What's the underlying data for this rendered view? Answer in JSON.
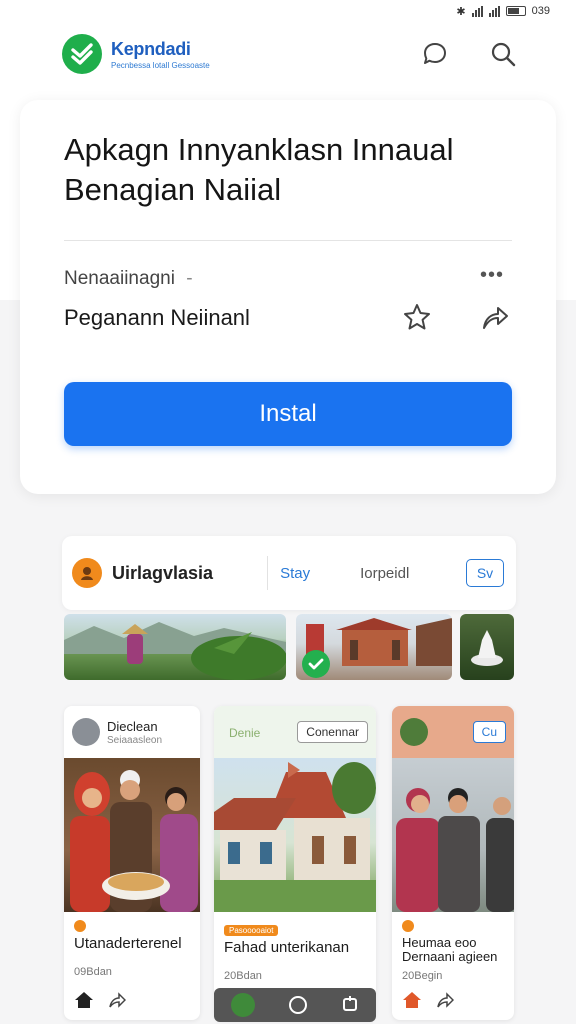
{
  "status_bar": {
    "time": "039"
  },
  "header": {
    "brand_name": "Kepndadi",
    "brand_tagline": "Pecnbessa lotall Gessoaste"
  },
  "app": {
    "title_line1": "Apkagn Innyanklasn Innaual",
    "title_line2": "Benagian Naiial",
    "developer": "Nenaaiinagni",
    "developer_suffix": "-",
    "more_label": "•••",
    "category": "Peganann Neiinanl",
    "install_label": "Instal"
  },
  "publisher_bar": {
    "name": "Uirlagvlasia",
    "tab_a": "Stay",
    "tab_b": "Iorpeidl",
    "button": "Sv"
  },
  "colors": {
    "accent": "#1a73f0",
    "brand_green": "#1fae4b",
    "orange": "#f08a1c"
  },
  "feed": [
    {
      "header_title": "Dieclean",
      "header_sub": "Seiaaasleon",
      "title": "Utanaderterenel",
      "meta": "09Bdan"
    },
    {
      "header_title": "",
      "header_sub": "Denie",
      "button": "Conennar",
      "badge": "Pasooooaiot",
      "title": "Fahad unterikanan",
      "meta": "20Bdan"
    },
    {
      "header_title": "",
      "header_sub": "",
      "button": "Cu",
      "title": "Heumaa eoo Dernaani agieen",
      "meta": "20Begin"
    }
  ]
}
